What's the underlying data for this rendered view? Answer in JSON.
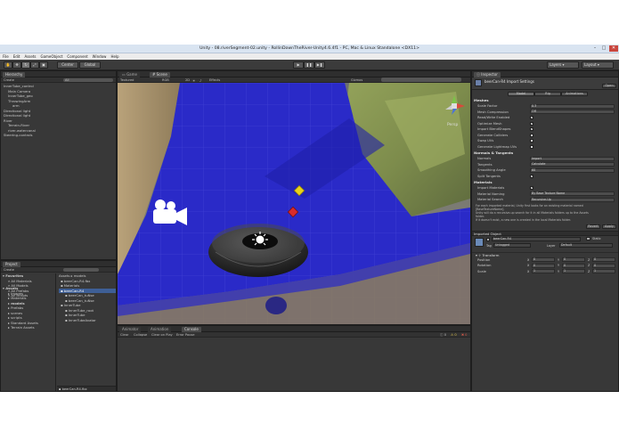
{
  "window": {
    "title": "Unity - 08.riverSegment-02.unity - RollinDownTheRiver-Unity4.6.4f1 - PC, Mac & Linux Standalone <DX11>",
    "controls": [
      "–",
      "□",
      "✕"
    ]
  },
  "menu": [
    "File",
    "Edit",
    "Assets",
    "GameObject",
    "Component",
    "Window",
    "Help"
  ],
  "toolbar": {
    "pivot_label": "Center",
    "space_label": "Global",
    "layers_label": "Layers",
    "layout_label": "Layout"
  },
  "hierarchy": {
    "tab": "Hierarchy",
    "create": "Create",
    "search_placeholder": "All",
    "items": [
      {
        "label": "InnerTube_control",
        "indent": 0,
        "selected": false
      },
      {
        "label": "Main Camera",
        "indent": 1,
        "selected": false
      },
      {
        "label": "InnerTube_geo",
        "indent": 1,
        "selected": false
      },
      {
        "label": "ThrowingArm",
        "indent": 1,
        "selected": false
      },
      {
        "label": "arm",
        "indent": 2,
        "selected": false
      },
      {
        "label": "Directional light",
        "indent": 0,
        "selected": false
      },
      {
        "label": "Directional light",
        "indent": 0,
        "selected": false
      },
      {
        "label": "River",
        "indent": 0,
        "selected": false
      },
      {
        "label": "Terrain-River",
        "indent": 1,
        "selected": false
      },
      {
        "label": "river-watercanal",
        "indent": 1,
        "selected": false
      },
      {
        "label": "Steering-controls",
        "indent": 0,
        "selected": false
      }
    ]
  },
  "scene": {
    "tabs": [
      "Game",
      "Scene"
    ],
    "shading": "Textured",
    "render": "RGB",
    "mode_2d": "2D",
    "effects": "Effects",
    "gizmos": "Gizmos",
    "persp": "Persp"
  },
  "project": {
    "tab": "Project",
    "create": "Create",
    "favorites_label": "Favorites",
    "favorites": [
      "All Materials",
      "All Models",
      "All Prefabs",
      "All Scripts"
    ],
    "assets_label": "Assets",
    "assets_tree": [
      "Images",
      "Materials",
      "models",
      "Prefabs",
      "scenes",
      "scripts",
      "Standard Assets",
      "Terrain Assets"
    ],
    "breadcrumb": [
      "Assets",
      "models"
    ],
    "files": [
      {
        "label": "beerCan-R4.fbx",
        "indent": 0,
        "selected": false
      },
      {
        "label": "Materials",
        "indent": 0,
        "selected": false
      },
      {
        "label": "beerCan-R4",
        "indent": 0,
        "selected": true
      },
      {
        "label": "beerCan_tuNse",
        "indent": 1,
        "selected": false
      },
      {
        "label": "beerCan_tuNse",
        "indent": 1,
        "selected": false
      },
      {
        "label": "InnerTube",
        "indent": 0,
        "selected": false
      },
      {
        "label": "InnerTube_root",
        "indent": 1,
        "selected": false
      },
      {
        "label": "InnerTube",
        "indent": 1,
        "selected": false
      },
      {
        "label": "InnerTubeAvatar",
        "indent": 1,
        "selected": false
      }
    ],
    "footer": "beerCan-R4.fbx"
  },
  "console": {
    "tabs": [
      "Animator",
      "Animation",
      "Console"
    ],
    "buttons": [
      "Clear",
      "Collapse",
      "Clear on Play",
      "Error Pause"
    ],
    "counts": [
      "0",
      "0",
      "0"
    ]
  },
  "inspector": {
    "tab": "Inspector",
    "title": "beerCan-R4 Import Settings",
    "open_label": "Open",
    "subtabs": [
      "Model",
      "Rig",
      "Animations"
    ],
    "meshes_header": "Meshes",
    "meshes": [
      {
        "key": "Scale Factor",
        "type": "field",
        "value": "0.3"
      },
      {
        "key": "Mesh Compression",
        "type": "field",
        "value": "Off"
      },
      {
        "key": "Read/Write Enabled",
        "type": "check",
        "value": "✓"
      },
      {
        "key": "Optimize Mesh",
        "type": "check",
        "value": "✓"
      },
      {
        "key": "Import BlendShapes",
        "type": "check",
        "value": "✓"
      },
      {
        "key": "Generate Colliders",
        "type": "check",
        "value": ""
      },
      {
        "key": "Swap UVs",
        "type": "check",
        "value": ""
      },
      {
        "key": "Generate Lightmap UVs",
        "type": "check",
        "value": ""
      }
    ],
    "normals_header": "Normals & Tangents",
    "normals": [
      {
        "key": "Normals",
        "type": "field",
        "value": "Import"
      },
      {
        "key": "Tangents",
        "type": "field",
        "value": "Calculate"
      },
      {
        "key": "Smoothing Angle",
        "type": "field",
        "value": "60"
      },
      {
        "key": "Split Tangents",
        "type": "check",
        "value": "✓"
      }
    ],
    "materials_header": "Materials",
    "materials": [
      {
        "key": "Import Materials",
        "type": "check",
        "value": "✓"
      },
      {
        "key": "Material Naming",
        "type": "field",
        "value": "By Base Texture Name"
      },
      {
        "key": "Material Search",
        "type": "field",
        "value": "Recursive-Up"
      }
    ],
    "help_text": [
      "For each imported material, Unity first looks for an existing material named",
      "[BaseTextureName].",
      "Unity will do a recursive-up search for it in all Materials folders up to the Assets",
      "folder.",
      "If it doesn't exist, a new one is created in the local Materials folder."
    ],
    "revert_label": "Revert",
    "apply_label": "Apply",
    "imported_header": "Imported Object",
    "object_name": "beerCan-R4",
    "static_label": "Static",
    "tag_label": "Tag",
    "tag_value": "Untagged",
    "layer_label": "Layer",
    "layer_value": "Default",
    "transform_label": "Transform",
    "transform": [
      {
        "key": "Position",
        "x": "0",
        "y": "0",
        "z": "0"
      },
      {
        "key": "Rotation",
        "x": "0",
        "y": "0",
        "z": "0"
      },
      {
        "key": "Scale",
        "x": "1",
        "y": "1",
        "z": "1"
      }
    ]
  },
  "colors": {
    "water": "#2a2ac8",
    "selection": "#3e5f96",
    "panel": "#383838"
  }
}
